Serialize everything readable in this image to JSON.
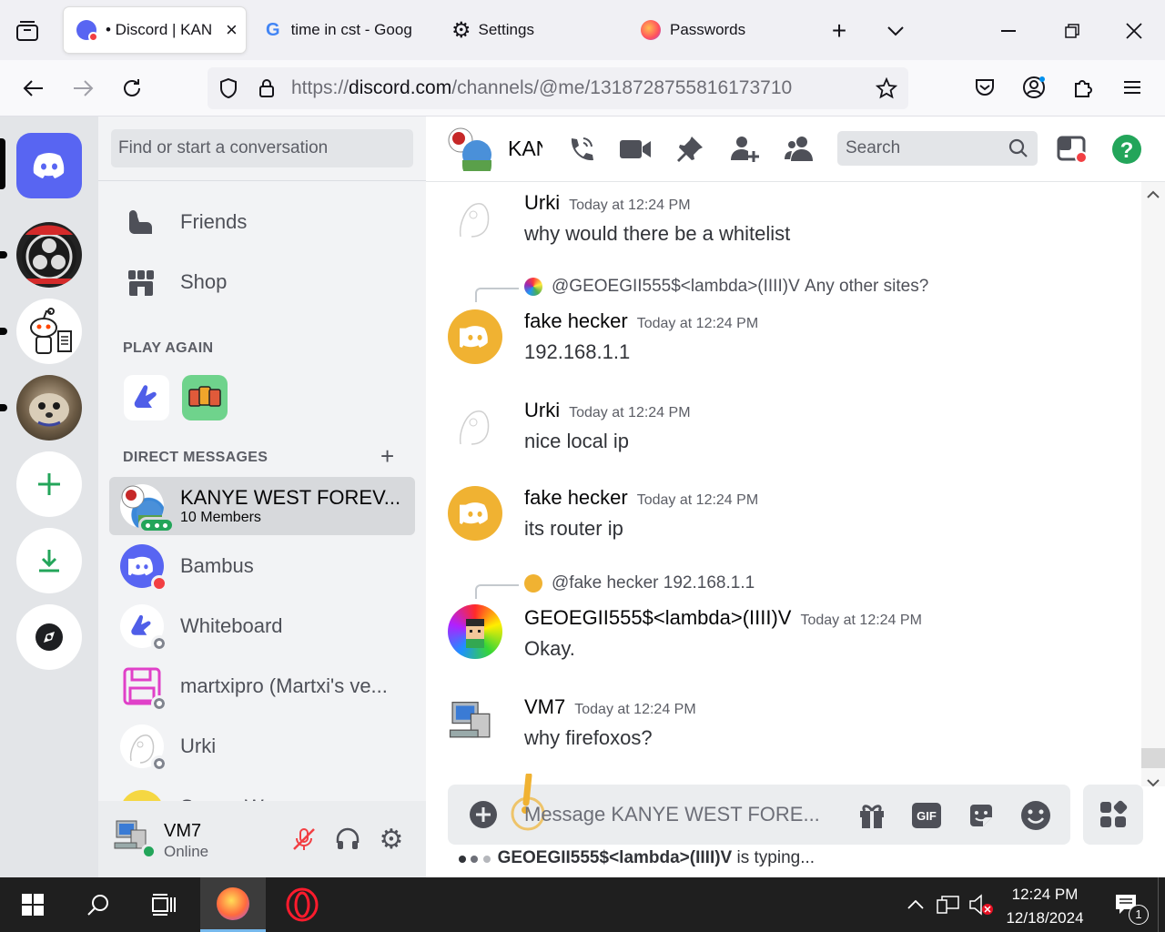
{
  "browser": {
    "tabs": [
      {
        "label": "• Discord | KAN",
        "active": true
      },
      {
        "label": "time in cst - Goog"
      },
      {
        "label": "Settings"
      },
      {
        "label": "Passwords"
      }
    ],
    "url_prefix": "https://",
    "url_domain": "discord.com",
    "url_path": "/channels/@me/1318728755816173710"
  },
  "dm_sidebar": {
    "search_placeholder": "Find or start a conversation",
    "nav": [
      {
        "label": "Friends"
      },
      {
        "label": "Shop"
      }
    ],
    "play_again_heading": "PLAY AGAIN",
    "direct_messages_heading": "DIRECT MESSAGES",
    "dms": [
      {
        "name": "KANYE WEST FOREV...",
        "subtitle": "10 Members"
      },
      {
        "name": "Bambus"
      },
      {
        "name": "Whiteboard"
      },
      {
        "name": "martxipro (Martxi's ve..."
      },
      {
        "name": "Urki"
      },
      {
        "name": "Server Worm users"
      }
    ]
  },
  "user_panel": {
    "name": "VM7",
    "status": "Online"
  },
  "chat": {
    "channel_name": "KAN",
    "search_placeholder": "Search",
    "messages": [
      {
        "author": "Urki",
        "time": "Today at 12:24 PM",
        "text": "why would there be a whitelist"
      },
      {
        "reply_to": "@GEOEGII555$<lambda>(IIII)V",
        "reply_text": "Any other sites?",
        "author": "fake hecker",
        "time": "Today at 12:24 PM",
        "text": "192.168.1.1"
      },
      {
        "author": "Urki",
        "time": "Today at 12:24 PM",
        "text": "nice local ip"
      },
      {
        "author": "fake hecker",
        "time": "Today at 12:24 PM",
        "text": "its router ip"
      },
      {
        "reply_to": "@fake hecker",
        "reply_text": "192.168.1.1",
        "author": "GEOEGII555$<lambda>(IIII)V",
        "time": "Today at 12:24 PM",
        "text": "Okay."
      },
      {
        "author": "VM7",
        "time": "Today at 12:24 PM",
        "text": "why firefoxos?"
      }
    ],
    "composer_placeholder": "Message KANYE WEST FORE...",
    "gif_label": "GIF",
    "typing_user": "GEOEGII555$<lambda>(IIII)V",
    "typing_suffix": "is typing..."
  },
  "taskbar": {
    "time": "12:24 PM",
    "date": "12/18/2024",
    "notification_count": "1"
  },
  "colors": {
    "discord_blurple": "#5865f2",
    "online_green": "#23a55a",
    "dnd_red": "#f23f43",
    "add_server_green": "#23a55a",
    "fake_hecker_avatar": "#f0b232"
  }
}
